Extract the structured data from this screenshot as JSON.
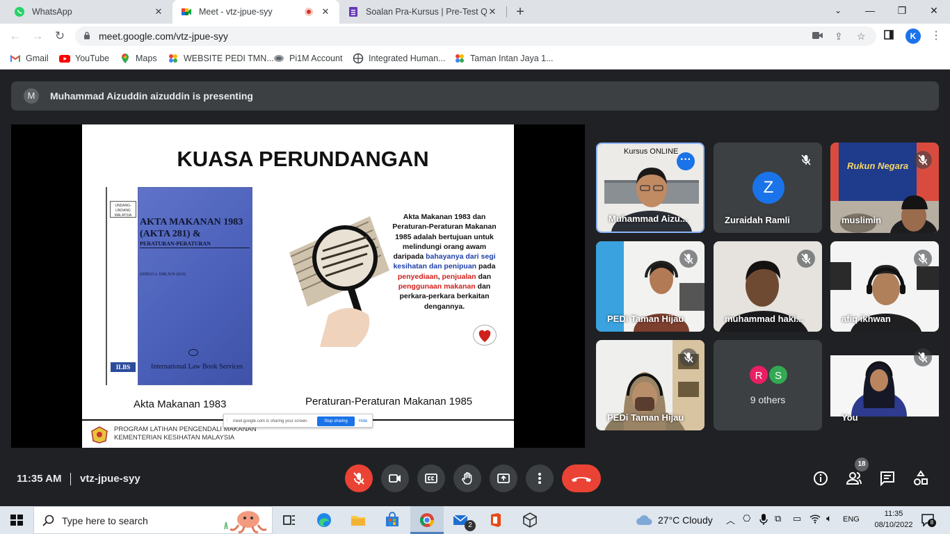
{
  "browser": {
    "tabs": [
      {
        "title": "WhatsApp",
        "active": false
      },
      {
        "title": "Meet - vtz-jpue-syy",
        "active": true
      },
      {
        "title": "Soalan Pra-Kursus | Pre-Test Que",
        "active": false
      }
    ],
    "url": "meet.google.com/vtz-jpue-syy",
    "profile_initial": "K",
    "bookmarks": [
      "Gmail",
      "YouTube",
      "Maps",
      "WEBSITE PEDI TMN...",
      "Pi1M Account",
      "Integrated Human...",
      "Taman Intan Jaya 1..."
    ]
  },
  "meet": {
    "presenter_initial": "M",
    "presenting_text": "Muhammad Aizuddin aizuddin is presenting",
    "slide": {
      "title": "KUASA PERUNDANGAN",
      "book_tag": "UNDANG-UNDANG MALAYSIA",
      "book_title_1": "AKTA MAKANAN 1983",
      "book_title_2": "(AKTA 281) &",
      "book_title_3": "PERATURAN-PERATURAN",
      "book_edition": "(HINGGA 1HB JUN 2019)",
      "book_publisher": "International Law Book Services",
      "book_logo": "ILBS",
      "caption_left": "Akta Makanan 1983",
      "caption_right": "Peraturan-Peraturan Makanan 1985",
      "text_1": "Akta Makanan 1983 dan Peraturan-Peraturan Makanan 1985 adalah bertujuan untuk melindungi orang awam daripada",
      "text_2": "bahayanya dari segi kesihatan dan penipuan",
      "text_3": "pada",
      "text_4": "penyediaan",
      "text_5": "penjualan",
      "text_6": "dan",
      "text_7": "penggunaan makanan",
      "text_8": "dan perkara-perkara berkaitan dengannya.",
      "footer_1": "PROGRAM LATIHAN PENGENDALI MAKANAN",
      "footer_2": "KEMENTERIAN KESIHATAN MALAYSIA",
      "sharing_text": "meet.google.com is sharing your screen.",
      "stop_sharing": "Stop sharing",
      "hide": "Hide"
    },
    "tiles": [
      {
        "name": "Muhammad Aizu...",
        "overlay": "Kursus ONLINE"
      },
      {
        "name": "Zuraidah Ramli",
        "initial": "Z"
      },
      {
        "name": "muslimin",
        "banner": "Rukun Negara"
      },
      {
        "name": "PEDi Taman Hijau"
      },
      {
        "name": "muhammad haki..."
      },
      {
        "name": "afiq ikhwan"
      },
      {
        "name": "PEDi Taman Hijau"
      },
      {
        "name": "9 others",
        "initials": [
          "R",
          "S"
        ]
      },
      {
        "name": "You"
      }
    ],
    "clock": "11:35 AM",
    "meeting_code": "vtz-jpue-syy",
    "people_count": "18"
  },
  "taskbar": {
    "search_placeholder": "Type here to search",
    "weather": "27°C  Cloudy",
    "lang": "ENG",
    "time": "11:35",
    "date": "08/10/2022",
    "mail_badge": "2",
    "notif_count": "8"
  },
  "colors": {
    "meet_bg": "#202124",
    "tile_bg": "#3c4043",
    "end_call": "#ea4335",
    "mic_off": "#ea4335",
    "accent": "#1a73e8"
  }
}
